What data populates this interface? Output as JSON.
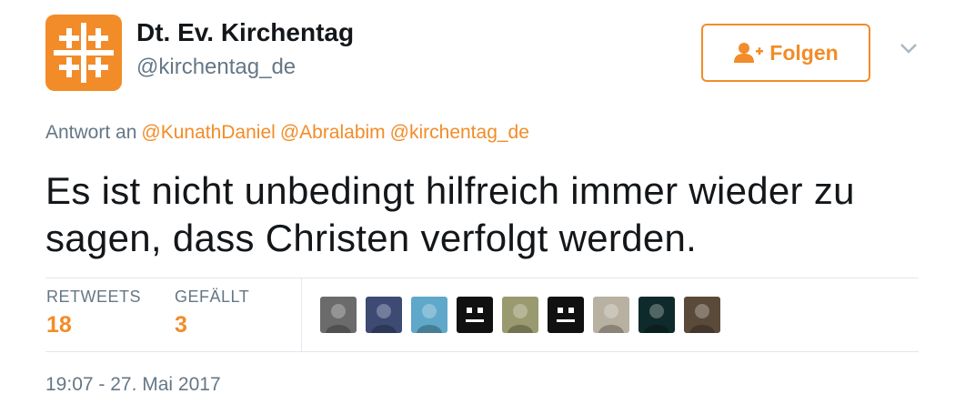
{
  "account": {
    "name": "Dt. Ev. Kirchentag",
    "handle": "@kirchentag_de",
    "avatar_icon": "kirchentag-cross-logo-icon",
    "brand_color": "#f28c28"
  },
  "follow_button": {
    "label": "Folgen",
    "icon": "add-user-icon"
  },
  "menu": {
    "icon": "chevron-down-icon"
  },
  "reply": {
    "prefix": "Antwort an",
    "mentions": [
      "@KunathDaniel",
      "@Abralabim",
      "@kirchentag_de"
    ]
  },
  "tweet": {
    "text": "Es ist nicht unbedingt hilfreich immer wieder zu sagen, dass Christen verfolgt werden."
  },
  "stats": {
    "retweets_label": "RETWEETS",
    "retweets_count": "18",
    "likes_label": "GEFÄLLT",
    "likes_count": "3"
  },
  "likers": [
    {
      "name": "liker-avatar-1",
      "color": "#6b6b6b",
      "dark": false
    },
    {
      "name": "liker-avatar-2",
      "color": "#3d4a73",
      "dark": false
    },
    {
      "name": "liker-avatar-3",
      "color": "#5fa8c9",
      "dark": false
    },
    {
      "name": "liker-avatar-4",
      "color": "#111111",
      "dark": true
    },
    {
      "name": "liker-avatar-5",
      "color": "#9a9a70",
      "dark": false
    },
    {
      "name": "liker-avatar-6",
      "color": "#111111",
      "dark": true
    },
    {
      "name": "liker-avatar-7",
      "color": "#b8b0a0",
      "dark": false
    },
    {
      "name": "liker-avatar-8",
      "color": "#0f2a2a",
      "dark": false
    },
    {
      "name": "liker-avatar-9",
      "color": "#5a4a3a",
      "dark": false
    }
  ],
  "timestamp": "19:07 - 27. Mai 2017"
}
